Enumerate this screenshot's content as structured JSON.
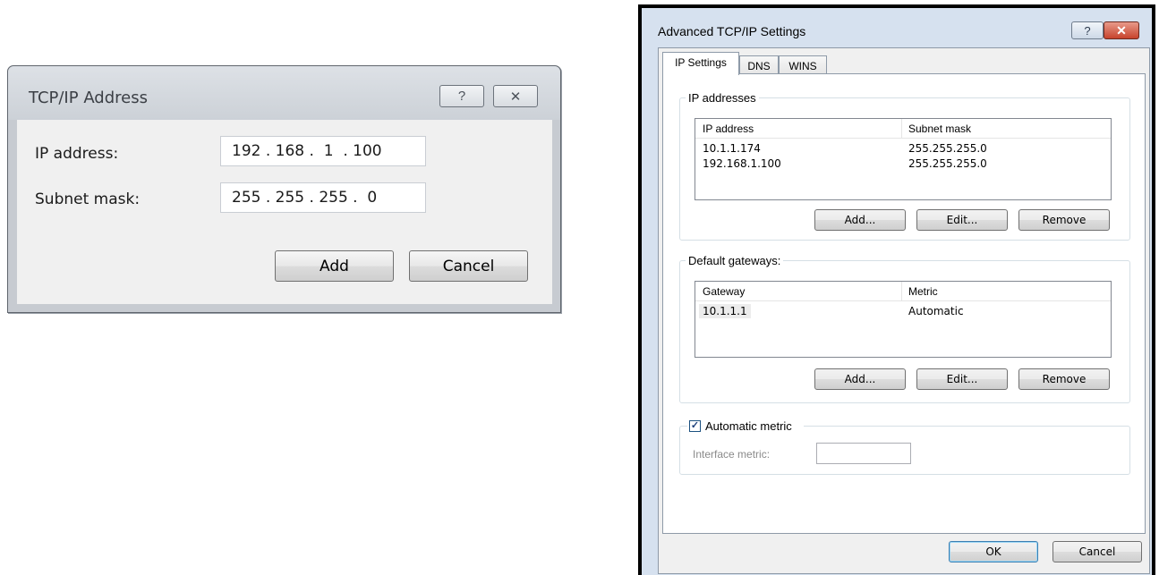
{
  "tcpip_dialog": {
    "title": "TCP/IP Address",
    "help_glyph": "?",
    "close_glyph": "✕",
    "ip_label": "IP address:",
    "ip_value": "192 . 168 .  1  . 100",
    "mask_label": "Subnet mask:",
    "mask_value": "255 . 255 . 255 .  0",
    "add_label": "Add",
    "cancel_label": "Cancel"
  },
  "advanced_dialog": {
    "title": "Advanced TCP/IP Settings",
    "help_glyph": "?",
    "close_glyph": "✕",
    "tabs": [
      {
        "label": "IP Settings",
        "active": true
      },
      {
        "label": "DNS",
        "active": false
      },
      {
        "label": "WINS",
        "active": false
      }
    ],
    "ip_group": {
      "title": "IP addresses",
      "columns": [
        "IP address",
        "Subnet mask"
      ],
      "rows": [
        [
          "10.1.1.174",
          "255.255.255.0"
        ],
        [
          "192.168.1.100",
          "255.255.255.0"
        ]
      ],
      "add_label": "Add...",
      "edit_label": "Edit...",
      "remove_label": "Remove"
    },
    "gateway_group": {
      "title": "Default gateways:",
      "columns": [
        "Gateway",
        "Metric"
      ],
      "rows": [
        [
          "10.1.1.1",
          "Automatic"
        ]
      ],
      "add_label": "Add...",
      "edit_label": "Edit...",
      "remove_label": "Remove"
    },
    "metric_group": {
      "checkbox_label": "Automatic metric",
      "checked": true,
      "interface_metric_label": "Interface metric:",
      "interface_metric_value": ""
    },
    "ok_label": "OK",
    "cancel_label": "Cancel"
  }
}
